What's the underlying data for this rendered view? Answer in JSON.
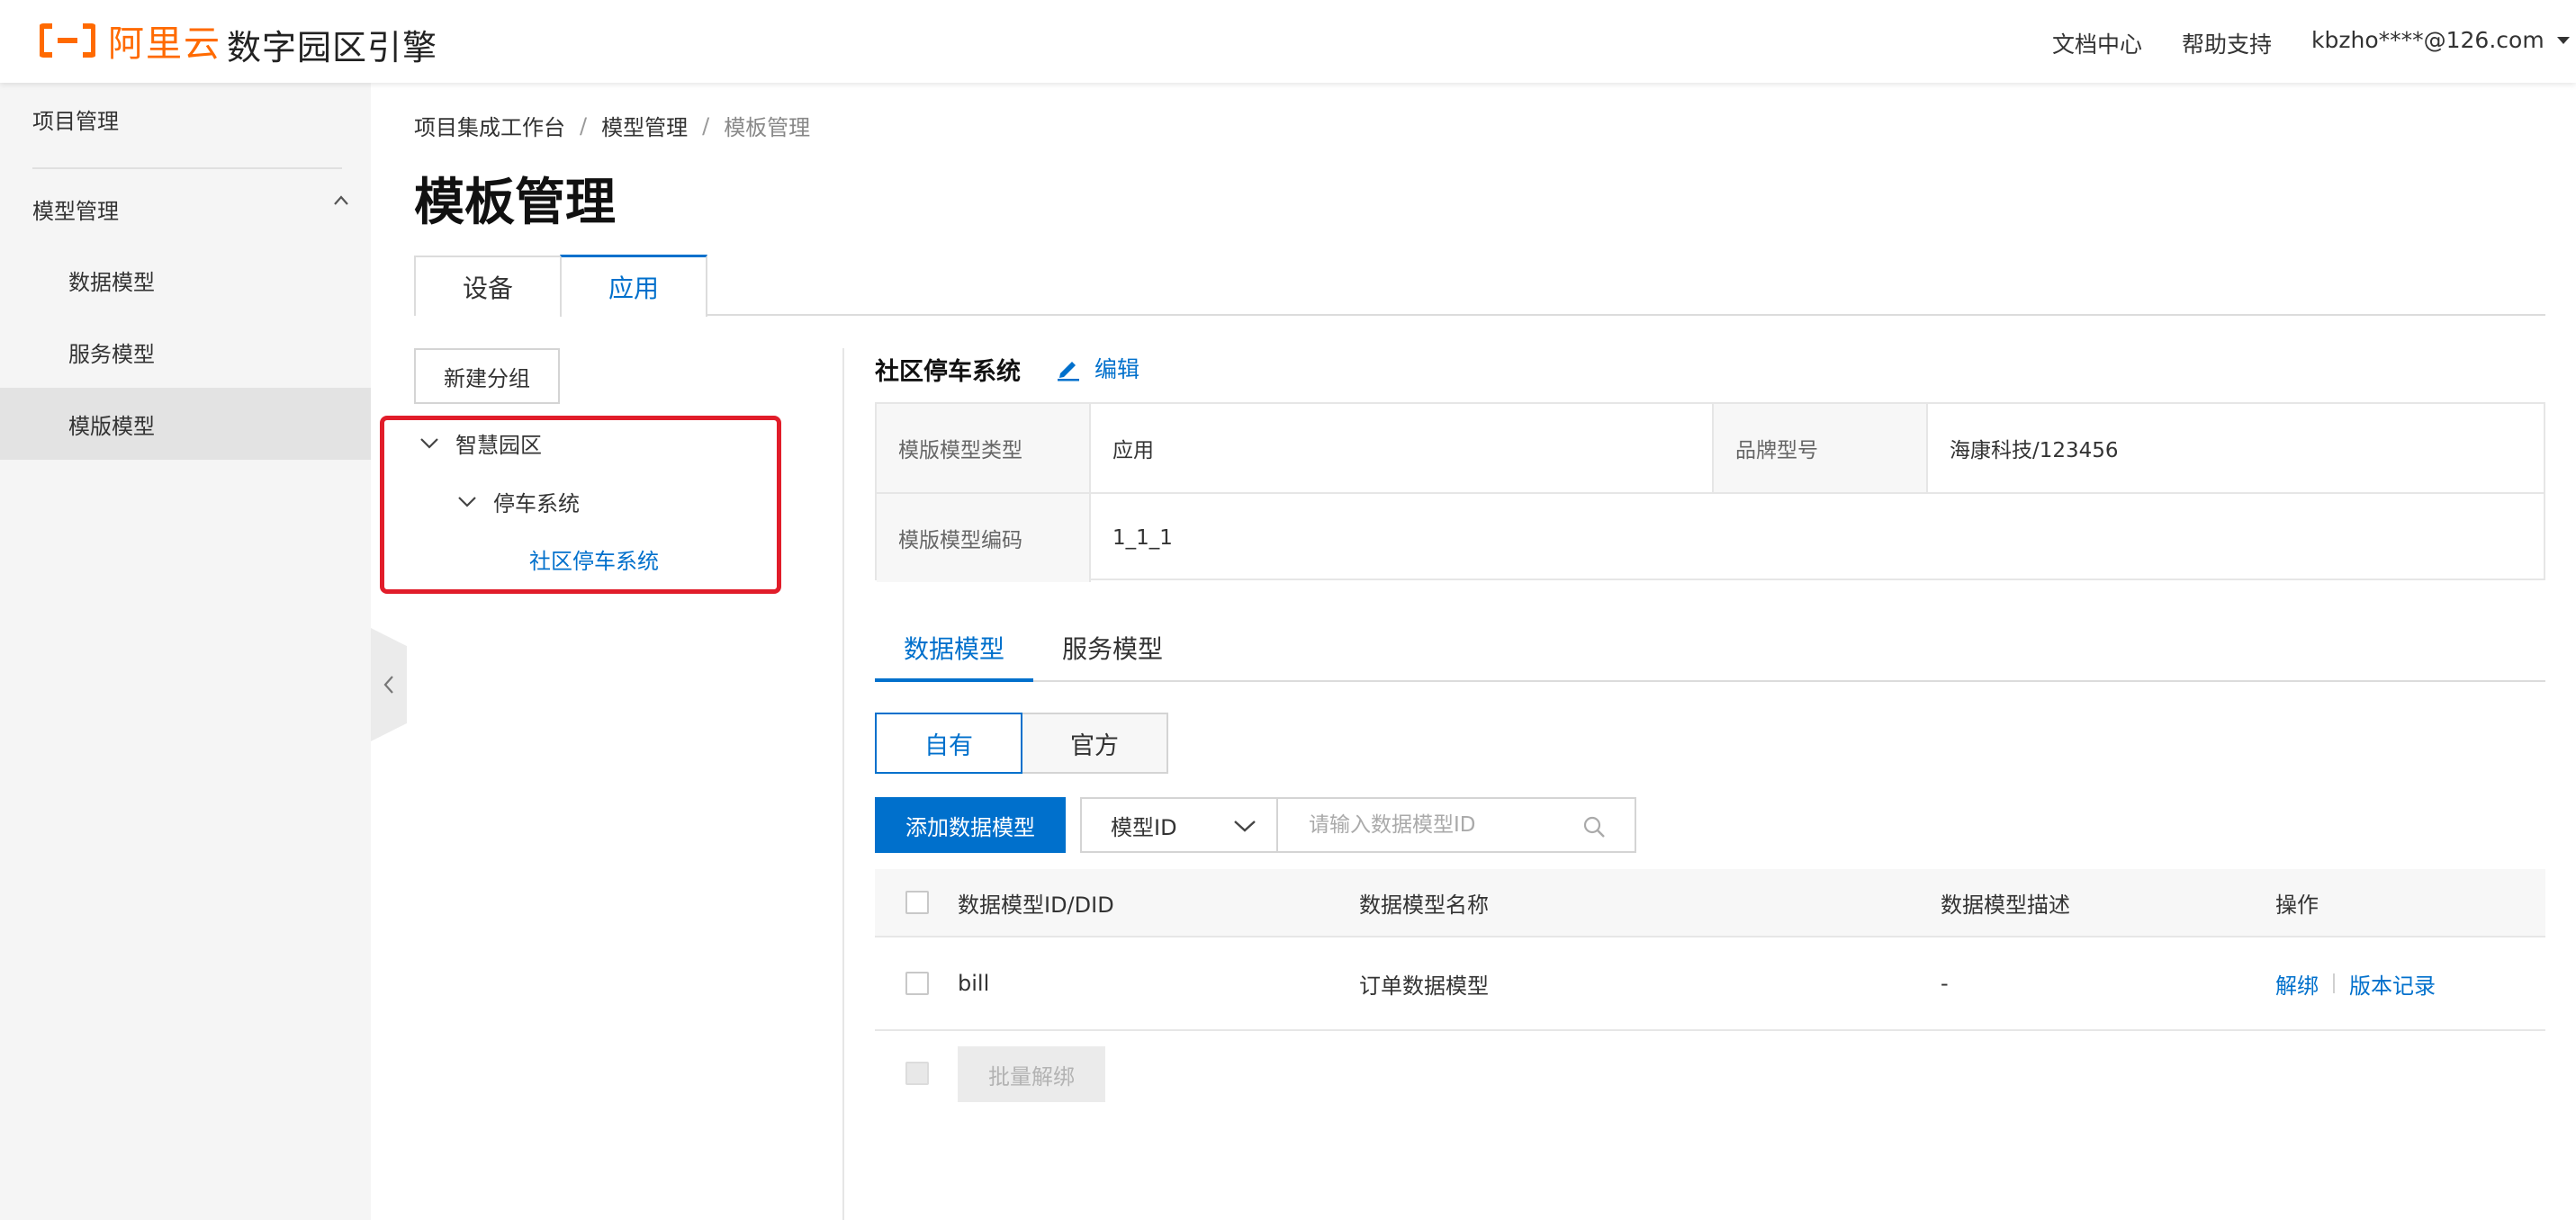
{
  "header": {
    "logo_text": "阿里云",
    "product_title": "数字园区引擎",
    "links": [
      "文档中心",
      "帮助支持"
    ],
    "user": "kbzho****@126.com",
    "brand_color": "#ff6a00"
  },
  "sidebar": {
    "items": [
      {
        "label": "项目管理"
      },
      {
        "label": "模型管理",
        "expanded": true
      },
      {
        "label": "数据模型"
      },
      {
        "label": "服务模型"
      },
      {
        "label": "模版模型",
        "active": true
      }
    ]
  },
  "breadcrumb": [
    "项目集成工作台",
    "模型管理",
    "模板管理"
  ],
  "page_title": "模板管理",
  "tabs": [
    {
      "label": "设备"
    },
    {
      "label": "应用",
      "active": true
    }
  ],
  "tree": {
    "new_group_button": "新建分组",
    "nodes": [
      "智慧园区",
      "停车系统",
      "社区停车系统"
    ]
  },
  "detail": {
    "title": "社区停车系统",
    "edit_label": "编辑",
    "info": {
      "type_label": "模版模型类型",
      "type_value": "应用",
      "brand_label": "品牌型号",
      "brand_value": "海康科技/123456",
      "code_label": "模版模型编码",
      "code_value": "1_1_1"
    },
    "sub_tabs": [
      {
        "label": "数据模型",
        "active": true
      },
      {
        "label": "服务模型"
      }
    ],
    "segments": [
      {
        "label": "自有",
        "active": true
      },
      {
        "label": "官方"
      }
    ],
    "toolbar": {
      "add_button": "添加数据模型",
      "select_value": "模型ID",
      "search_placeholder": "请输入数据模型ID"
    },
    "table": {
      "columns": [
        "数据模型ID/DID",
        "数据模型名称",
        "数据模型描述",
        "操作"
      ],
      "rows": [
        {
          "id": "bill",
          "name": "订单数据模型",
          "desc": "-",
          "actions": [
            "解绑",
            "版本记录"
          ]
        }
      ],
      "batch_button": "批量解绑"
    }
  },
  "colors": {
    "accent": "#0070cc",
    "highlight_border": "#e11d2a"
  }
}
